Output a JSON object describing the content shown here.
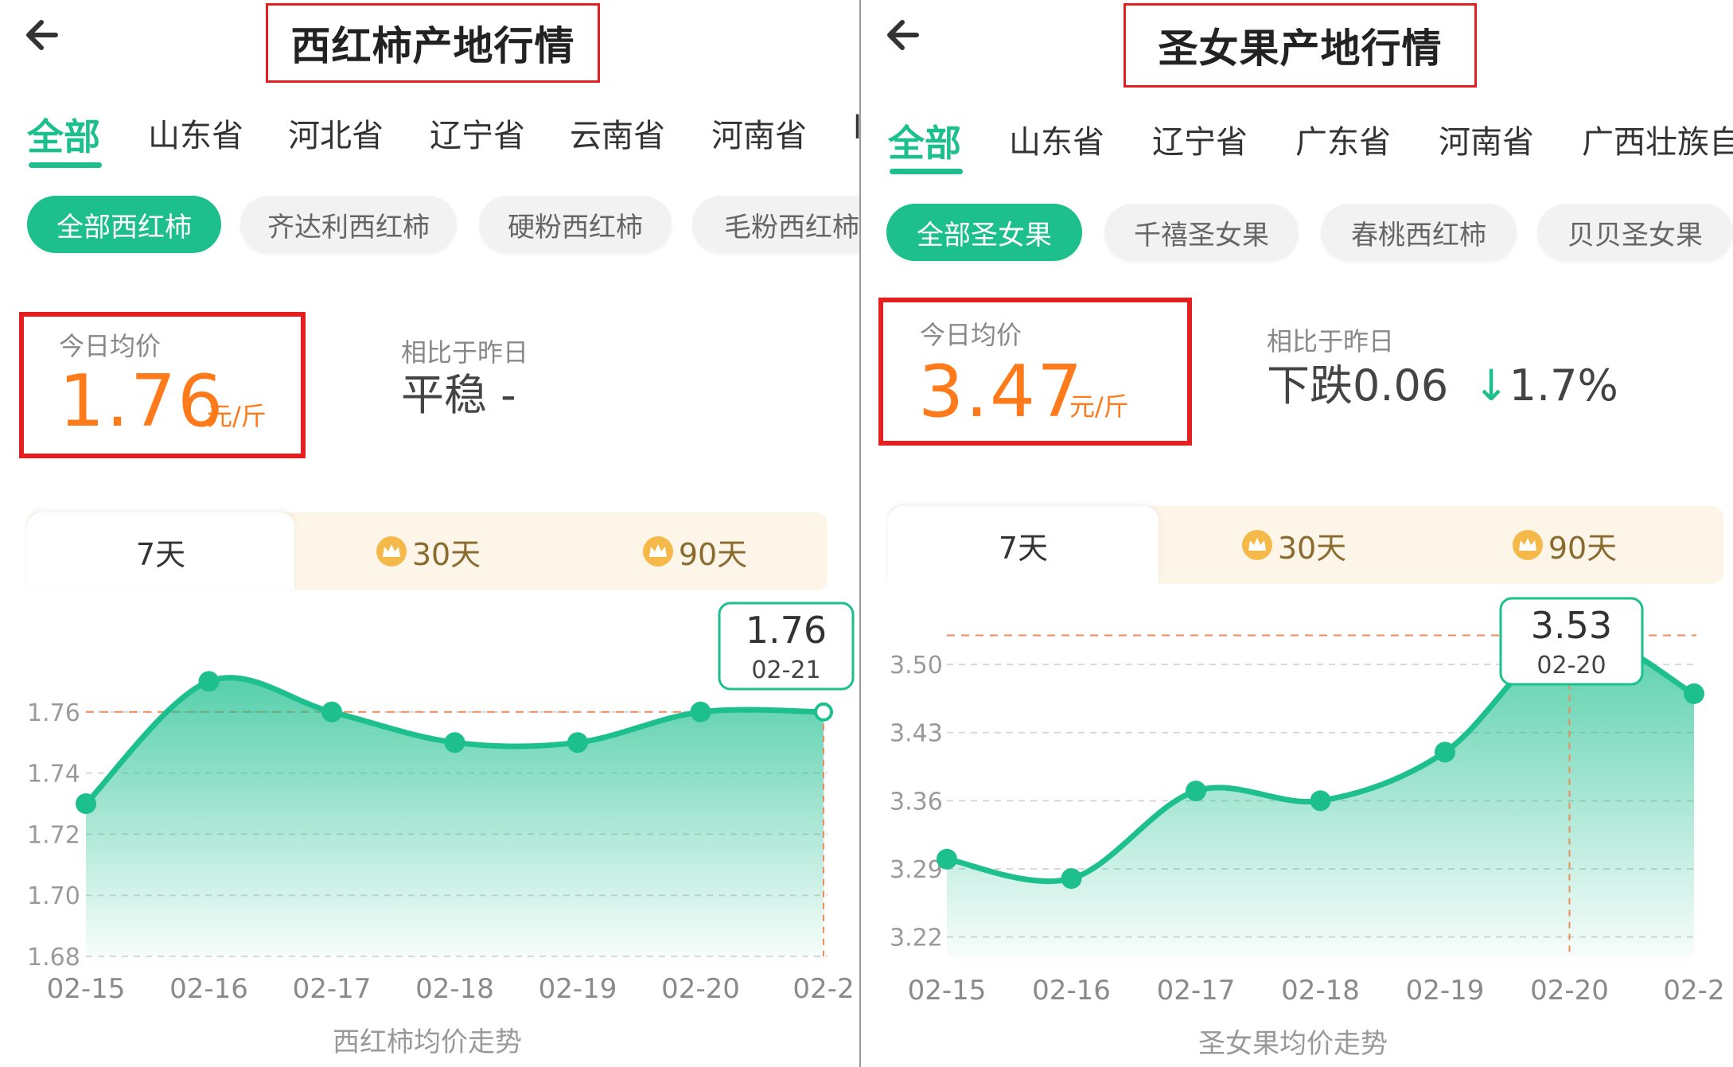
{
  "colors": {
    "accent": "#1dbf8d",
    "price": "#ff7a1a",
    "highlight": "#e41f1f"
  },
  "left": {
    "title": "西红柿产地行情",
    "tabs": [
      "全部",
      "山东省",
      "河北省",
      "辽宁省",
      "云南省",
      "河南省",
      "l"
    ],
    "chips": [
      "全部西红柿",
      "齐达利西红柿",
      "硬粉西红柿",
      "毛粉西红柿"
    ],
    "avg_label": "今日均价",
    "avg_value": "1.76",
    "unit": "元/斤",
    "compare_label": "相比于昨日",
    "compare_value": "平稳 -",
    "range_tabs": [
      "7天",
      "30天",
      "90天"
    ],
    "caption": "西红柿均价走势",
    "tooltip": {
      "value": "1.76",
      "date": "02-21"
    }
  },
  "right": {
    "title": "圣女果产地行情",
    "tabs": [
      "全部",
      "山东省",
      "辽宁省",
      "广东省",
      "河南省",
      "广西壮族自"
    ],
    "chips": [
      "全部圣女果",
      "千禧圣女果",
      "春桃西红柿",
      "贝贝圣女果"
    ],
    "avg_label": "今日均价",
    "avg_value": "3.47",
    "unit": "元/斤",
    "compare_label": "相比于昨日",
    "compare_text": "下跌0.06",
    "compare_arrow": "↓",
    "compare_pct": "1.7%",
    "range_tabs": [
      "7天",
      "30天",
      "90天"
    ],
    "caption": "圣女果均价走势",
    "tooltip": {
      "value": "3.53",
      "date": "02-20"
    }
  },
  "chart_data": [
    {
      "type": "area",
      "x": [
        "02-15",
        "02-16",
        "02-17",
        "02-18",
        "02-19",
        "02-20",
        "02-2"
      ],
      "values": [
        1.73,
        1.77,
        1.76,
        1.75,
        1.75,
        1.76,
        1.76
      ],
      "ylim": [
        1.68,
        1.78
      ],
      "yticks": [
        "1.68",
        "1.70",
        "1.72",
        "1.74",
        "1.76"
      ],
      "ytick_values": [
        1.68,
        1.7,
        1.72,
        1.74,
        1.76
      ],
      "reference_line": 1.76,
      "highlight_index": 6,
      "grid": true
    },
    {
      "type": "area",
      "x": [
        "02-15",
        "02-16",
        "02-17",
        "02-18",
        "02-19",
        "02-20",
        "02-2"
      ],
      "values": [
        3.3,
        3.28,
        3.37,
        3.36,
        3.41,
        3.53,
        3.47
      ],
      "ylim": [
        3.2,
        3.55
      ],
      "yticks": [
        "3.22",
        "3.29",
        "3.36",
        "3.43",
        "3.50"
      ],
      "ytick_values": [
        3.22,
        3.29,
        3.36,
        3.43,
        3.5
      ],
      "reference_line": 3.53,
      "highlight_index": 5,
      "grid": true
    }
  ]
}
